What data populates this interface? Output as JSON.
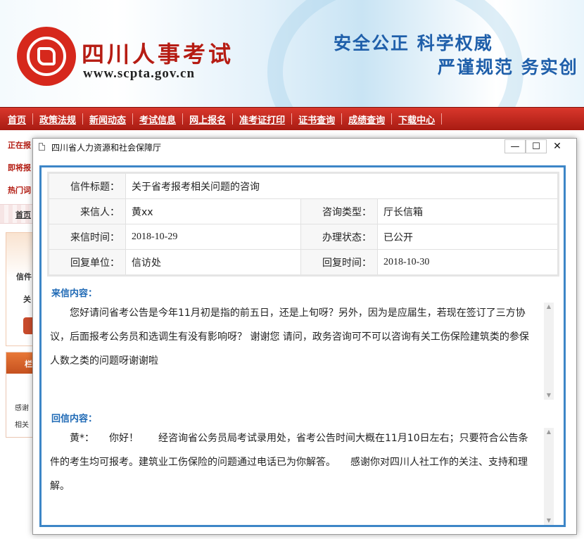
{
  "header": {
    "site_name": "四川人事考试",
    "site_url": "www.scpta.gov.cn",
    "slogan_line1": "安全公正 科学权威",
    "slogan_line2": "严谨规范 务实创"
  },
  "nav": {
    "items": [
      "首页",
      "政策法规",
      "新闻动态",
      "考试信息",
      "网上报名",
      "准考证打印",
      "证书查询",
      "成绩查询",
      "下载中心"
    ]
  },
  "background_page": {
    "left_labels": [
      "正在报",
      "即将报",
      "热门词"
    ],
    "home_link": "首页",
    "box1_title": "信件",
    "box1_sub": "关",
    "box2_head": "栏",
    "box2_line1": "感谢",
    "box2_line2": "相关"
  },
  "dialog": {
    "title": "四川省人力资源和社会保障厅",
    "min_symbol": "—",
    "max_symbol": "☐",
    "close_symbol": "✕",
    "letter_info": {
      "subject_label": "信件标题：",
      "subject": "关于省考报考相关问题的咨询",
      "sender_label": "来信人：",
      "sender": "黄xx",
      "type_label": "咨询类型：",
      "type": "厅长信箱",
      "date_label": "来信时间：",
      "date": "2018-10-29",
      "status_label": "办理状态：",
      "status": "已公开",
      "reply_unit_label": "回复单位：",
      "reply_unit": "信访处",
      "reply_date_label": "回复时间：",
      "reply_date": "2018-10-30"
    },
    "letter_section_title": "来信内容：",
    "letter_body": "您好请问省考公告是今年11月初是指的前五日，还是上旬呀？另外，因为是应届生，若现在签订了三方协议，后面报考公务员和选调生有没有影响呀？ 谢谢您 请问，政务咨询可不可以咨询有关工伤保险建筑类的参保人数之类的问题呀谢谢啦",
    "reply_section_title": "回信内容：",
    "reply_body": "黄*：　　你好！　　经咨询省公务员局考试录用处，省考公告时间大概在11月10日左右；只要符合公告条件的考生均可报考。建筑业工伤保险的问题通过电话已为你解答。　　感谢你对四川人社工作的关注、支持和理解。"
  }
}
